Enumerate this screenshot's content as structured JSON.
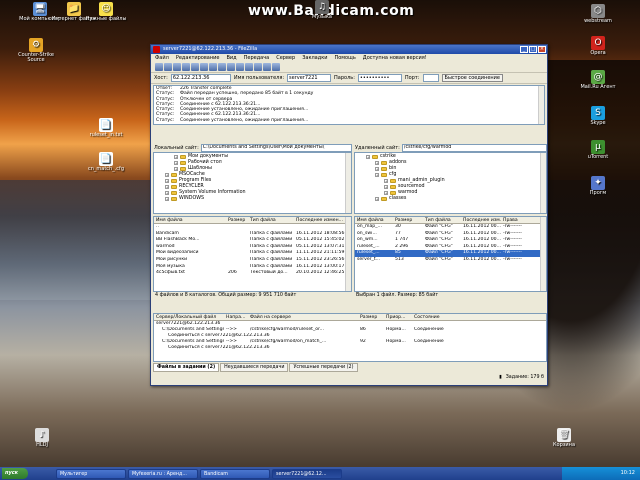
{
  "recording": {
    "watermark": "www.Bandicam.com"
  },
  "desktop": {
    "icons": [
      {
        "label": "Мой компьютер",
        "glyph": "🖥"
      },
      {
        "label": "Интернет файлы",
        "glyph": "📁"
      },
      {
        "label": "Нужные файлы",
        "glyph": "☺"
      },
      {
        "label": "Музыка",
        "glyph": "♫"
      },
      {
        "label": "Counter-Strike Source",
        "glyph": "⚙"
      },
      {
        "label": "ruleset_in.txt",
        "glyph": "📄"
      },
      {
        "label": "cn_match_.cfg",
        "glyph": "📄"
      },
      {
        "label": "webstream",
        "glyph": "⬡"
      },
      {
        "label": "Opera",
        "glyph": "O"
      },
      {
        "label": "Mail.Ru Агент",
        "glyph": "@"
      },
      {
        "label": "Skype",
        "glyph": "S"
      },
      {
        "label": "uTorrent",
        "glyph": "µ"
      },
      {
        "label": "Прогм",
        "glyph": "✦"
      },
      {
        "label": "HLDJ",
        "glyph": "♪"
      },
      {
        "label": "Корзина",
        "glyph": "🗑"
      }
    ]
  },
  "window": {
    "title": "server7221@62.122.213.36 - FileZilla",
    "menu": [
      "Файл",
      "Редактирование",
      "Вид",
      "Передача",
      "Сервер",
      "Закладки",
      "Помощь",
      "Доступна новая версия!"
    ],
    "quickconnect": {
      "host_label": "Хост:",
      "host_value": "62.122.213.36",
      "user_label": "Имя пользователя:",
      "user_value": "server7221",
      "pass_label": "Пароль:",
      "pass_value": "••••••••••",
      "port_label": "Порт:",
      "port_value": "",
      "button": "Быстрое соединение"
    },
    "log": [
      {
        "k": "Ответ:",
        "v": "226 Transfer complete"
      },
      {
        "k": "Статус:",
        "v": "Файл передан успешно, передано 85 байт в 1 секунду"
      },
      {
        "k": "Статус:",
        "v": "Отключен от сервера"
      },
      {
        "k": "Статус:",
        "v": "Соединение с 62.122.213.36:21..."
      },
      {
        "k": "Статус:",
        "v": "Соединение установлено, ожидание приглашения..."
      },
      {
        "k": "Статус:",
        "v": "Соединение с 62.122.213.36:21..."
      },
      {
        "k": "Статус:",
        "v": "Соединение установлено, ожидание приглашения..."
      }
    ],
    "local": {
      "site_label": "Локальный сайт:",
      "site_value": "C:\\Documents and Settings\\User\\Мои документы\\",
      "tree": [
        {
          "indent": 2,
          "label": "Мои документы"
        },
        {
          "indent": 2,
          "label": "Рабочий стол"
        },
        {
          "indent": 2,
          "label": "Шаблоны"
        },
        {
          "indent": 1,
          "label": "MSOCache"
        },
        {
          "indent": 1,
          "label": "Program Files"
        },
        {
          "indent": 1,
          "label": "RECYCLER"
        },
        {
          "indent": 1,
          "label": "System Volume Information"
        },
        {
          "indent": 1,
          "label": "WINDOWS"
        }
      ],
      "columns": [
        "Имя файла",
        "Размер",
        "Тип файла",
        "Последнее измен..."
      ],
      "rows": [
        [
          "..",
          "",
          "",
          ""
        ],
        [
          "Bandicam",
          "",
          "Папка с файлами",
          "16.11.2012 18:08:56"
        ],
        [
          "BB FlashBack Mo...",
          "",
          "Папка с файлами",
          "05.11.2012 15:45:02"
        ],
        [
          "warmod",
          "",
          "Папка с файлами",
          "05.11.2012 13:07:31"
        ],
        [
          "Мои видеозаписи",
          "",
          "Папка с файлами",
          "11.11.2012 21:11:59"
        ],
        [
          "Мои рисунки",
          "",
          "Папка с файлами",
          "15.11.2012 23:26:56"
        ],
        [
          "Моя музыка",
          "",
          "Папка с файлами",
          "16.11.2012 13:00:17"
        ],
        [
          "4с5сфыв.txt",
          "206",
          "Текстовый до...",
          "20.10.2012 12:46:25"
        ]
      ],
      "status": "4 файлов и 8 каталогов. Общий размер: 9 951 710 байт"
    },
    "remote": {
      "site_label": "Удаленный сайт:",
      "site_value": "/cstrike/cfg/warmod",
      "tree": [
        {
          "indent": 1,
          "label": "cstrike"
        },
        {
          "indent": 2,
          "label": "addons"
        },
        {
          "indent": 2,
          "label": "bin"
        },
        {
          "indent": 2,
          "label": "cfg"
        },
        {
          "indent": 3,
          "label": "mani_admin_plugin"
        },
        {
          "indent": 3,
          "label": "sourcemod"
        },
        {
          "indent": 3,
          "label": "warmod"
        },
        {
          "indent": 2,
          "label": "classes"
        }
      ],
      "columns": [
        "Имя файла",
        "Размер",
        "Тип файла",
        "Последнее изм...",
        "Права"
      ],
      "rows": [
        [
          "on_map_...",
          "30",
          "Файл \"CFG\"",
          "16.11.2012 00...",
          "-rw-------"
        ],
        [
          "on_swi...",
          "77",
          "Файл \"CFG\"",
          "16.11.2012 00...",
          "-rw-------"
        ],
        [
          "on_wm...",
          "1 747",
          "Файл \"CFG\"",
          "16.11.2012 00...",
          "-rw-------"
        ],
        [
          "ruleset_...",
          "2 296",
          "Файл \"CFG\"",
          "16.11.2012 00...",
          "-rw-------"
        ],
        [
          "ruleset_...",
          "85",
          "Файл \"CFG\"",
          "16.11.2012 00...",
          "-rw-------"
        ],
        [
          "server_t...",
          "513",
          "Файл \"CFG\"",
          "16.11.2012 00...",
          "-rw-------"
        ]
      ],
      "status": "Выбран 1 файл. Размер: 85 байт"
    },
    "queue": {
      "columns": [
        "Сервер/Локальный файл",
        "Напра...",
        "Файл на сервере",
        "Размер",
        "Приор...",
        "Состояние"
      ],
      "rows": [
        [
          "server7221@62.122.213.36",
          "",
          "",
          "",
          "",
          ""
        ],
        [
          "C:\\Documents and Settings\\...",
          "-->>",
          "/cstrike/cfg/warmod/ruleset_or...",
          "86",
          "Норма...",
          "Соединение"
        ],
        [
          "Соединиться с server7221@62.122.213.36",
          "",
          "",
          "",
          "",
          ""
        ],
        [
          "C:\\Documents and Settings\\...",
          "-->>",
          "/cstrike/cfg/warmod/on_match_...",
          "92",
          "Норма...",
          "Соединение"
        ],
        [
          "Соединиться с server7221@62.122.213.36",
          "",
          "",
          "",
          "",
          ""
        ]
      ],
      "tabs": [
        "Файлы в задании (2)",
        "Неудавшиеся передачи",
        "Успешные передачи (2)"
      ],
      "status": "Задание: 179 б"
    }
  },
  "taskbar": {
    "start": "пуск",
    "tasks": [
      "Мультигер",
      "Myfexeria.ru : Аренд...",
      "Bandicam",
      "server7221@62.12..."
    ],
    "clock": "10:12"
  }
}
